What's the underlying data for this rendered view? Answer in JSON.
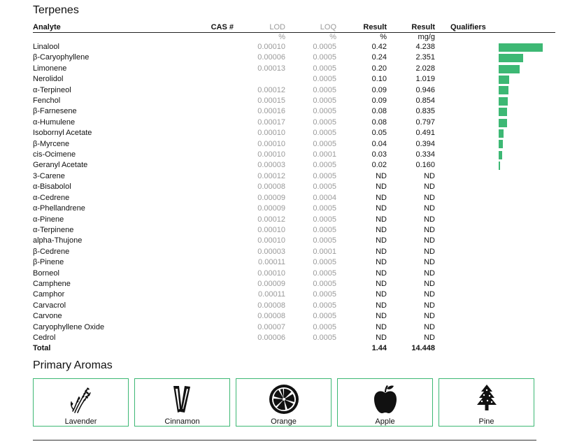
{
  "terpenes": {
    "title": "Terpenes",
    "headers": {
      "analyte": "Analyte",
      "cas": "CAS #",
      "lod": "LOD",
      "loq": "LOQ",
      "result_pct": "Result",
      "result_mg": "Result",
      "qualifiers": "Qualifiers"
    },
    "units": {
      "lod": "%",
      "loq": "%",
      "result_pct": "%",
      "result_mg": "mg/g"
    },
    "rows": [
      {
        "analyte": "Linalool",
        "lod": "0.00010",
        "loq": "0.0005",
        "pct": "0.42",
        "mg": "4.238",
        "bar": 4.238
      },
      {
        "analyte": "β-Caryophyllene",
        "lod": "0.00006",
        "loq": "0.0005",
        "pct": "0.24",
        "mg": "2.351",
        "bar": 2.351
      },
      {
        "analyte": "Limonene",
        "lod": "0.00013",
        "loq": "0.0005",
        "pct": "0.20",
        "mg": "2.028",
        "bar": 2.028
      },
      {
        "analyte": "Nerolidol",
        "lod": "",
        "loq": "0.0005",
        "pct": "0.10",
        "mg": "1.019",
        "bar": 1.019
      },
      {
        "analyte": "α-Terpineol",
        "lod": "0.00012",
        "loq": "0.0005",
        "pct": "0.09",
        "mg": "0.946",
        "bar": 0.946
      },
      {
        "analyte": "Fenchol",
        "lod": "0.00015",
        "loq": "0.0005",
        "pct": "0.09",
        "mg": "0.854",
        "bar": 0.854
      },
      {
        "analyte": "β-Farnesene",
        "lod": "0.00016",
        "loq": "0.0005",
        "pct": "0.08",
        "mg": "0.835",
        "bar": 0.835
      },
      {
        "analyte": "α-Humulene",
        "lod": "0.00017",
        "loq": "0.0005",
        "pct": "0.08",
        "mg": "0.797",
        "bar": 0.797
      },
      {
        "analyte": "Isobornyl Acetate",
        "lod": "0.00010",
        "loq": "0.0005",
        "pct": "0.05",
        "mg": "0.491",
        "bar": 0.491
      },
      {
        "analyte": "β-Myrcene",
        "lod": "0.00010",
        "loq": "0.0005",
        "pct": "0.04",
        "mg": "0.394",
        "bar": 0.394
      },
      {
        "analyte": "cis-Ocimene",
        "lod": "0.00010",
        "loq": "0.0001",
        "pct": "0.03",
        "mg": "0.334",
        "bar": 0.334
      },
      {
        "analyte": "Geranyl Acetate",
        "lod": "0.00003",
        "loq": "0.0005",
        "pct": "0.02",
        "mg": "0.160",
        "bar": 0.16
      },
      {
        "analyte": "3-Carene",
        "lod": "0.00012",
        "loq": "0.0005",
        "pct": "ND",
        "mg": "ND",
        "bar": 0
      },
      {
        "analyte": "α-Bisabolol",
        "lod": "0.00008",
        "loq": "0.0005",
        "pct": "ND",
        "mg": "ND",
        "bar": 0
      },
      {
        "analyte": "α-Cedrene",
        "lod": "0.00009",
        "loq": "0.0004",
        "pct": "ND",
        "mg": "ND",
        "bar": 0
      },
      {
        "analyte": "α-Phellandrene",
        "lod": "0.00009",
        "loq": "0.0005",
        "pct": "ND",
        "mg": "ND",
        "bar": 0
      },
      {
        "analyte": "α-Pinene",
        "lod": "0.00012",
        "loq": "0.0005",
        "pct": "ND",
        "mg": "ND",
        "bar": 0
      },
      {
        "analyte": "α-Terpinene",
        "lod": "0.00010",
        "loq": "0.0005",
        "pct": "ND",
        "mg": "ND",
        "bar": 0
      },
      {
        "analyte": "alpha-Thujone",
        "lod": "0.00010",
        "loq": "0.0005",
        "pct": "ND",
        "mg": "ND",
        "bar": 0
      },
      {
        "analyte": "β-Cedrene",
        "lod": "0.00003",
        "loq": "0.0001",
        "pct": "ND",
        "mg": "ND",
        "bar": 0
      },
      {
        "analyte": "β-Pinene",
        "lod": "0.00011",
        "loq": "0.0005",
        "pct": "ND",
        "mg": "ND",
        "bar": 0
      },
      {
        "analyte": "Borneol",
        "lod": "0.00010",
        "loq": "0.0005",
        "pct": "ND",
        "mg": "ND",
        "bar": 0
      },
      {
        "analyte": "Camphene",
        "lod": "0.00009",
        "loq": "0.0005",
        "pct": "ND",
        "mg": "ND",
        "bar": 0
      },
      {
        "analyte": "Camphor",
        "lod": "0.00011",
        "loq": "0.0005",
        "pct": "ND",
        "mg": "ND",
        "bar": 0
      },
      {
        "analyte": "Carvacrol",
        "lod": "0.00008",
        "loq": "0.0005",
        "pct": "ND",
        "mg": "ND",
        "bar": 0
      },
      {
        "analyte": "Carvone",
        "lod": "0.00008",
        "loq": "0.0005",
        "pct": "ND",
        "mg": "ND",
        "bar": 0
      },
      {
        "analyte": "Caryophyllene Oxide",
        "lod": "0.00007",
        "loq": "0.0005",
        "pct": "ND",
        "mg": "ND",
        "bar": 0
      },
      {
        "analyte": "Cedrol",
        "lod": "0.00006",
        "loq": "0.0005",
        "pct": "ND",
        "mg": "ND",
        "bar": 0
      }
    ],
    "total": {
      "label": "Total",
      "pct": "1.44",
      "mg": "14.448"
    },
    "bar_color": "#3db874",
    "bar_max": 4.238
  },
  "aromas": {
    "title": "Primary Aromas",
    "items": [
      {
        "label": "Lavender",
        "icon": "lavender-icon"
      },
      {
        "label": "Cinnamon",
        "icon": "cinnamon-icon"
      },
      {
        "label": "Orange",
        "icon": "orange-icon"
      },
      {
        "label": "Apple",
        "icon": "apple-icon"
      },
      {
        "label": "Pine",
        "icon": "pine-icon"
      }
    ],
    "border_color": "#3db874"
  }
}
